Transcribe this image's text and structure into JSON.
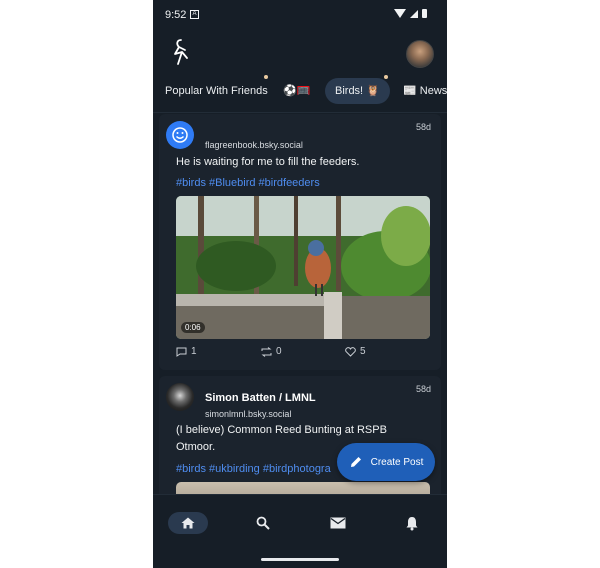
{
  "status_bar": {
    "time": "9:52",
    "notification_icon": "A"
  },
  "header": {
    "logo_icon": "bird-logo-icon",
    "avatar_icon": "avatar-icon"
  },
  "feed_tabs": [
    {
      "label": "Popular With Friends",
      "active": false
    },
    {
      "label": "⚽🥅",
      "active": false
    },
    {
      "label": "Birds! 🦉",
      "active": true
    },
    {
      "label": "📰 News",
      "active": false
    }
  ],
  "posts": [
    {
      "display_name": "",
      "handle": "flagreenbook.bsky.social",
      "age": "58d",
      "text": "He is waiting for me to fill the feeders.",
      "tags": "#birds #Bluebird #birdfeeders",
      "video_duration": "0:06",
      "replies": "1",
      "reposts": "0",
      "likes": "5"
    },
    {
      "display_name": "Simon Batten / LMNL",
      "handle": "simonlmnl.bsky.social",
      "age": "58d",
      "text_line1": "(I believe) Common Reed Bunting at RSPB",
      "text_line2": "Otmoor.",
      "tags": "#birds #ukbirding #birdphotogra"
    }
  ],
  "fab": {
    "label": "Create Post"
  },
  "nav": {
    "home": "home-icon",
    "search": "search-icon",
    "messages": "mail-icon",
    "notifications": "bell-icon"
  },
  "colors": {
    "background": "#161e27",
    "card": "#1b232d",
    "accent": "#4f8df0",
    "fab": "#1f5fb8"
  }
}
